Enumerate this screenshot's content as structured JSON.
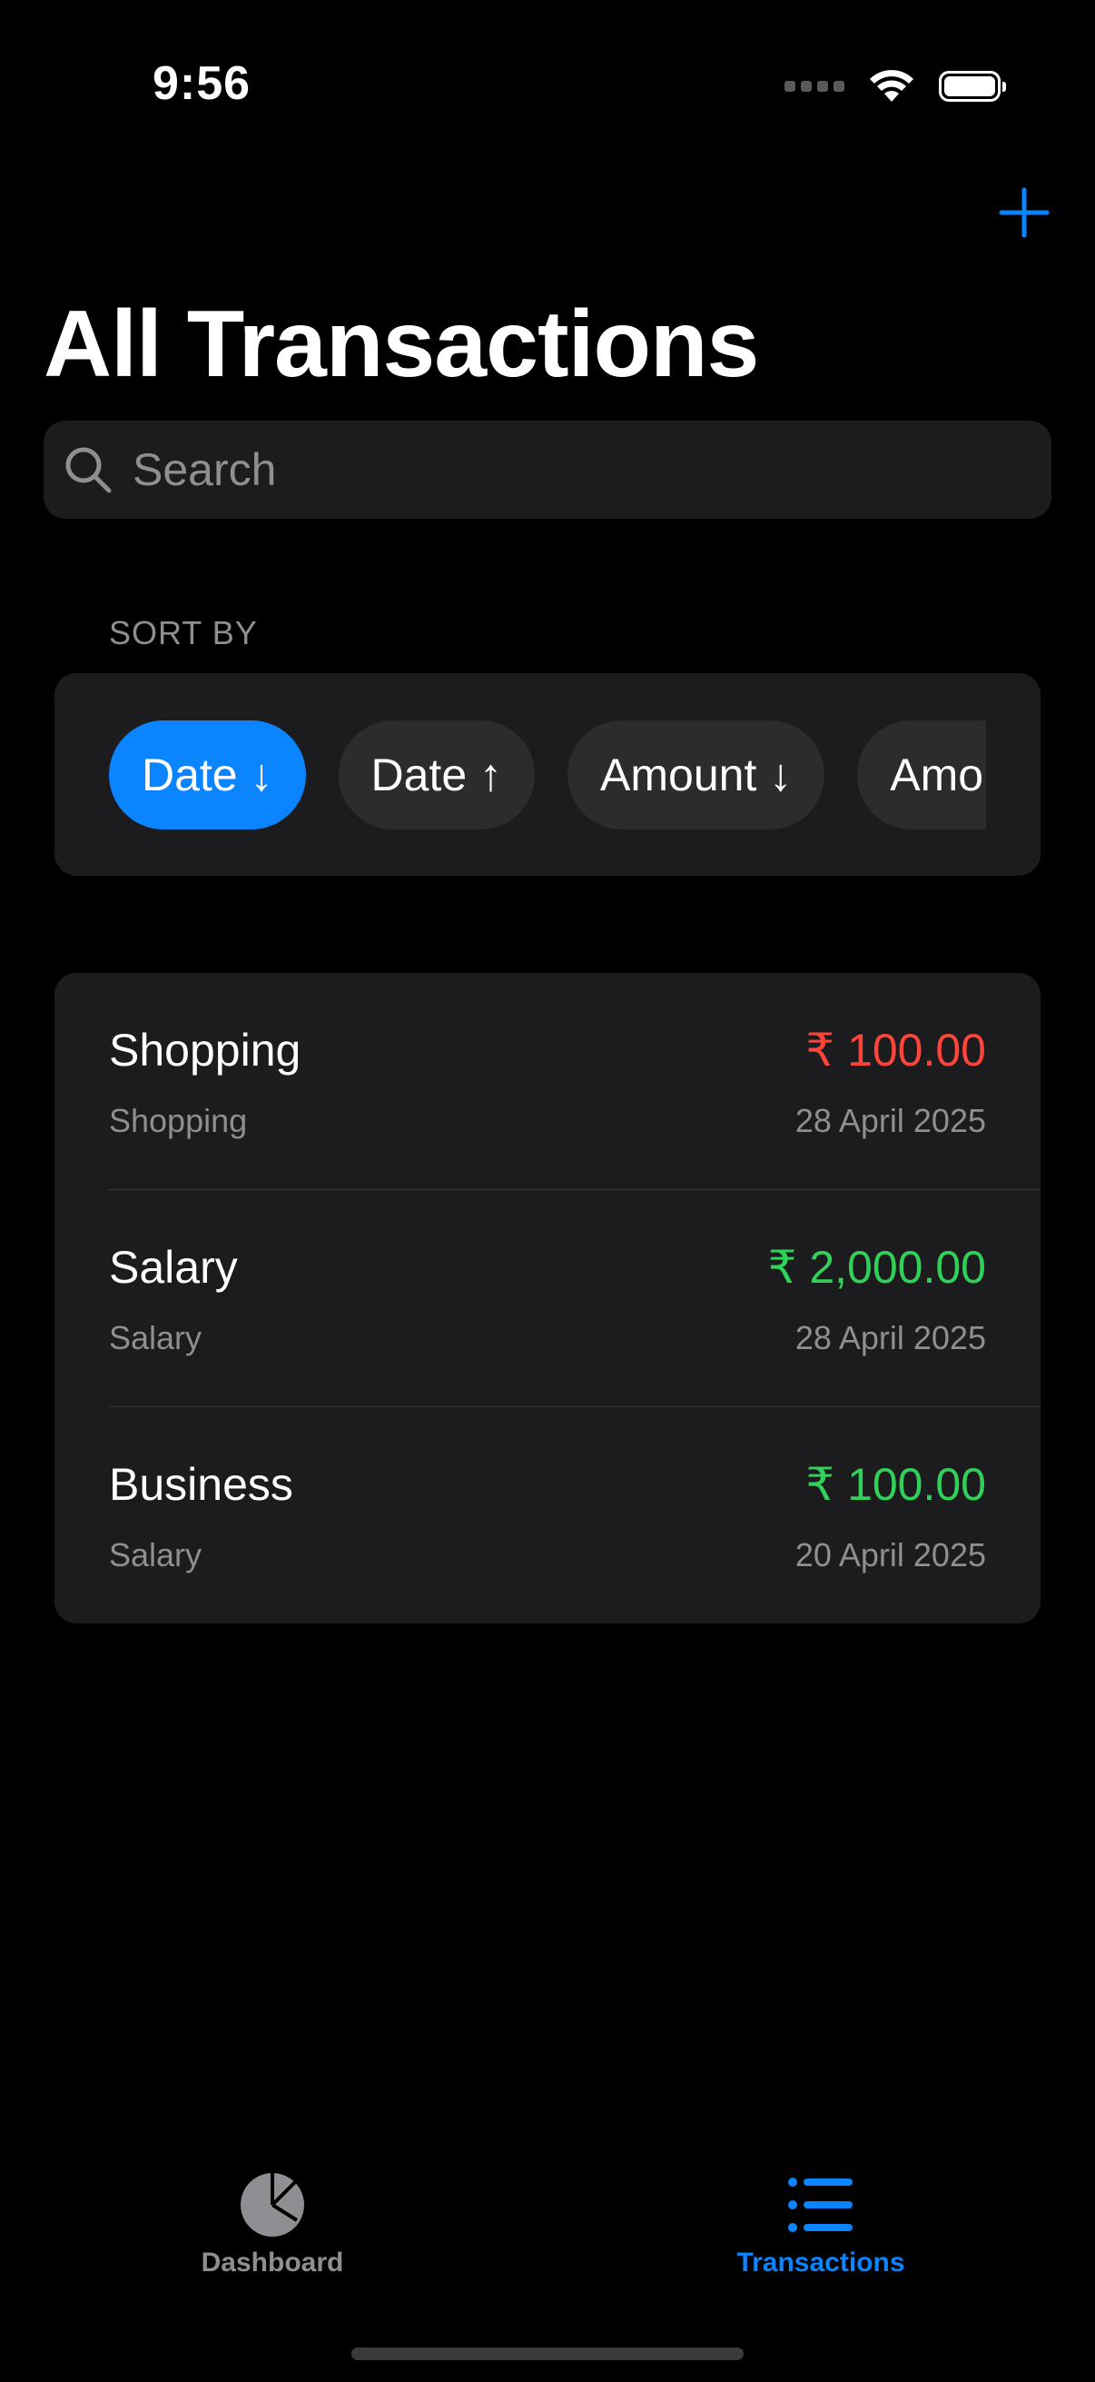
{
  "status_bar": {
    "time": "9:56"
  },
  "header": {
    "title": "All Transactions",
    "add_icon": "plus-icon"
  },
  "search": {
    "placeholder": "Search",
    "value": ""
  },
  "sort": {
    "label": "SORT BY",
    "options": [
      {
        "label": "Date ↓",
        "selected": true
      },
      {
        "label": "Date ↑",
        "selected": false
      },
      {
        "label": "Amount ↓",
        "selected": false
      },
      {
        "label": "Amount ↑",
        "selected": false
      }
    ]
  },
  "transactions": [
    {
      "title": "Shopping",
      "category": "Shopping",
      "amount": "₹ 100.00",
      "date": "28 April 2025",
      "type": "expense"
    },
    {
      "title": "Salary",
      "category": "Salary",
      "amount": "₹ 2,000.00",
      "date": "28 April 2025",
      "type": "income"
    },
    {
      "title": "Business",
      "category": "Salary",
      "amount": "₹ 100.00",
      "date": "20 April 2025",
      "type": "income"
    }
  ],
  "tab_bar": {
    "tabs": [
      {
        "label": "Dashboard",
        "icon": "pie-chart-icon",
        "active": false
      },
      {
        "label": "Transactions",
        "icon": "list-icon",
        "active": true
      }
    ]
  },
  "colors": {
    "accent": "#0a84ff",
    "expense": "#ff453a",
    "income": "#30d158",
    "inactive": "#8e8e93"
  }
}
